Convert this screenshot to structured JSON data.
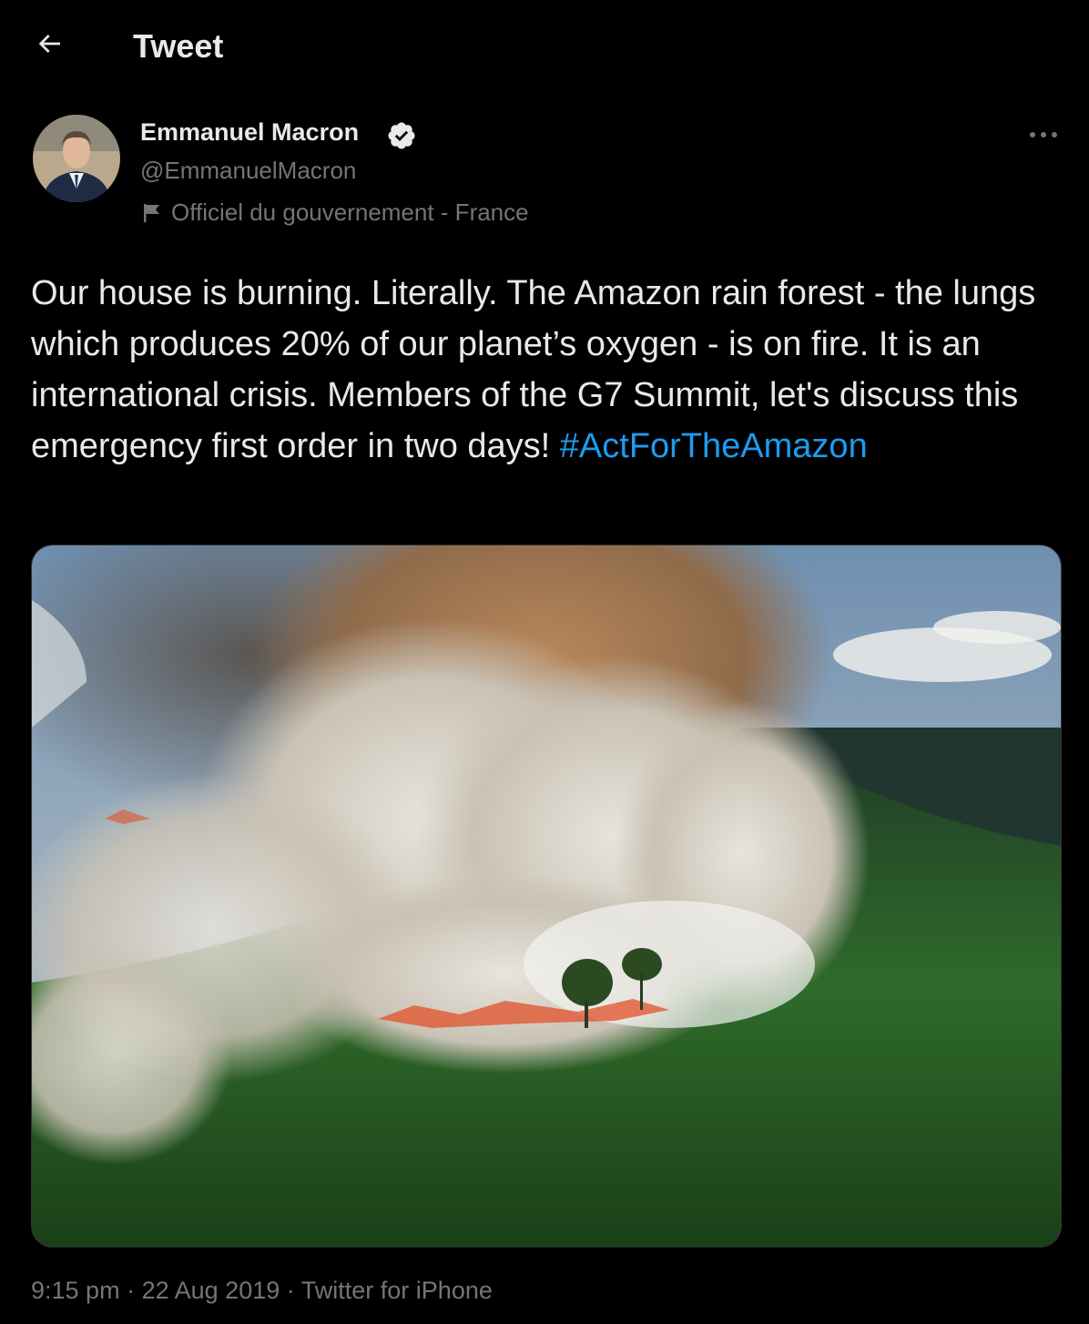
{
  "header": {
    "title": "Tweet",
    "back_icon": "arrow-left-icon"
  },
  "author": {
    "name": "Emmanuel Macron",
    "handle": "@EmmanuelMacron",
    "verified_icon": "verified-badge-icon",
    "label_icon": "flag-icon",
    "label": "Officiel du gouvernement - France"
  },
  "more_icon": "more-horizontal-icon",
  "tweet": {
    "text": "Our house is burning. Literally. The Amazon rain forest - the lungs which produces 20% of our planet’s oxygen - is on fire. It is an international crisis. Members of the G7 Summit, let's discuss this emergency first order in two days! ",
    "hashtag": "#ActForTheAmazon"
  },
  "meta": {
    "time": "9:15 pm",
    "separator": "·",
    "date": "22 Aug 2019",
    "source": "Twitter for iPhone"
  },
  "colors": {
    "background": "#000000",
    "text": "#e7e9ea",
    "secondary": "#71767b",
    "accent": "#1d9bf0"
  }
}
